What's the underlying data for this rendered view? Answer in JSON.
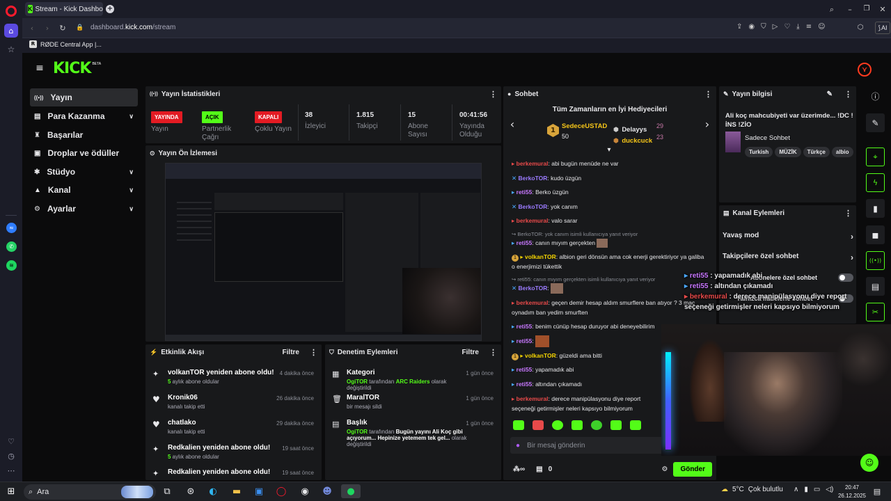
{
  "browser": {
    "tab_title": "Stream - Kick Dashboard",
    "new_tab": "+",
    "url_host_pre": "dashboard.",
    "url_host": "kick.com",
    "url_path": "/stream",
    "bookmark": "RØDE Central App |...",
    "ai_label": "AI"
  },
  "kick": {
    "logo": "KICK",
    "logo_sup": "BETA"
  },
  "nav": [
    {
      "label": "Yayın",
      "icon": "((•))",
      "active": true,
      "chev": ""
    },
    {
      "label": "Para Kazanma",
      "icon": "▤",
      "chev": "v"
    },
    {
      "label": "Başarılar",
      "icon": "🏆",
      "chev": ""
    },
    {
      "label": "Droplar ve ödüller",
      "icon": "▣",
      "chev": ""
    },
    {
      "label": "Stüdyo",
      "icon": "✱",
      "chev": "v"
    },
    {
      "label": "Kanal",
      "icon": "▲",
      "chev": "v"
    },
    {
      "label": "Ayarlar",
      "icon": "⚙",
      "chev": "v"
    }
  ],
  "stats": {
    "title": "Yayın İstatistikleri",
    "items": [
      {
        "value": "YAYINDA",
        "label": "Yayın",
        "badge": "red"
      },
      {
        "value": "AÇIK",
        "label": "Partnerlik Çağrı",
        "badge": "green"
      },
      {
        "value": "KAPALI",
        "label": "Çoklu Yayın",
        "badge": "red"
      },
      {
        "value": "38",
        "label": "İzleyici"
      },
      {
        "value": "1.815",
        "label": "Takipçi"
      },
      {
        "value": "15",
        "label": "Abone Sayısı"
      },
      {
        "value": "00:41:56",
        "label": "Yayında Olduğu"
      }
    ]
  },
  "preview": {
    "title": "Yayın Ön İzlemesi"
  },
  "activity": {
    "title": "Etkinlik Akışı",
    "filter": "Filtre",
    "events": [
      {
        "icon": "✦",
        "title": "volkanTOR yeniden abone oldu!",
        "sub_hl": "5",
        "sub": " aylık abone oldular",
        "time": "4 dakika önce"
      },
      {
        "icon": "♥",
        "title": "Kronik06",
        "sub": "kanalı takip etti",
        "time": "26 dakika önce"
      },
      {
        "icon": "♥",
        "title": "chatlako",
        "sub": "kanalı takip etti",
        "time": "29 dakika önce"
      },
      {
        "icon": "✦",
        "title": "Redkalien yeniden abone oldu!",
        "sub_hl": "5",
        "sub": " aylık abone oldular",
        "time": "19 saat önce"
      },
      {
        "icon": "✦",
        "title": "Redkalien yeniden abone oldu!",
        "sub": "",
        "time": "19 saat önce"
      }
    ]
  },
  "moderation": {
    "title": "Denetim Eylemleri",
    "filter": "Filtre",
    "events": [
      {
        "icon": "▦",
        "title": "Kategori",
        "actor": "OgiTOR",
        "mid": " tarafından ",
        "obj": "ARC Raiders",
        "tail": " olarak değiştirildi",
        "time": "1 gün önce"
      },
      {
        "icon": "🗑",
        "title": "MaralTOR",
        "tail": "bir mesajı sildi",
        "time": "1 gün önce"
      },
      {
        "icon": "▤",
        "title": "Başlık",
        "actor": "OgiTOR",
        "mid": " tarafından ",
        "obj": "Bugün yayını Ali Koç gibi açıyorum... Hepinize yetemem tek gel...",
        "tail": " olarak değiştirildi",
        "time": "1 gün önce"
      }
    ]
  },
  "chat": {
    "title": "Sohbet",
    "gifters_title": "Tüm Zamanların en İyi Hediyecileri",
    "gifters": [
      {
        "rank": "1",
        "name": "SedeceUSTAD",
        "count": "50"
      },
      {
        "rank": "",
        "name": "Delayys",
        "count": "29"
      },
      {
        "rank": "",
        "name": "duckcuck",
        "count": "23"
      }
    ],
    "messages": [
      {
        "user": "berkemural",
        "color": "#e84a4a",
        "text": "abi bugün menüde ne var"
      },
      {
        "user": "BerkoTOR",
        "color": "#9b7bff",
        "text": "kudo üzgün"
      },
      {
        "user": "reti55",
        "color": "#c878ff",
        "text": "Berko üzgün"
      },
      {
        "user": "BerkoTOR",
        "color": "#9b7bff",
        "text": "yok canım"
      },
      {
        "user": "berkemural",
        "color": "#e84a4a",
        "text": "valo sarar"
      },
      {
        "reply": "↪ BerkoTOR: yok canım isimli kullanıcıya yanıt veriyor"
      },
      {
        "user": "reti55",
        "color": "#c878ff",
        "text": "canın mıyım gerçekten"
      },
      {
        "user": "volkanTOR",
        "color": "#f5d400",
        "text": "albion geri dönsün ama cok enerji gerektiriyor ya galiba o enerjimizi tükettik"
      },
      {
        "reply": "↪ reti55: canın mıyım gerçekten isimli kullanıcıya yanıt veriyor"
      },
      {
        "user": "BerkoTOR",
        "color": "#9b7bff",
        "text": ""
      },
      {
        "user": "berkemural",
        "color": "#e84a4a",
        "text": "geçen demir hesap aldım smurflere ban atıyor ? 3 maç oynadım ban yedim smurften"
      },
      {
        "user": "reti55",
        "color": "#c878ff",
        "text": "benim cünüp hesap duruyor abi deneyebilirim"
      },
      {
        "user": "reti55",
        "color": "#c878ff",
        "text": ""
      },
      {
        "user": "volkanTOR",
        "color": "#f5d400",
        "text": "güzeldi ama bitti"
      },
      {
        "user": "reti55",
        "color": "#c878ff",
        "text": "yapamadık abi"
      },
      {
        "user": "reti55",
        "color": "#c878ff",
        "text": "altından çıkamadı"
      },
      {
        "user": "berkemural",
        "color": "#e84a4a",
        "text": "derece manipülasyonu diye report seçeneği getirmişler neleri kapsıyo bilmiyorum"
      }
    ],
    "input_placeholder": "Bir mesaj gönderin",
    "points": "0",
    "send": "Gönder"
  },
  "stream_info": {
    "title": "Yayın bilgisi",
    "stream_title": "Ali koç mahcubiyeti var üzerimde... !DC !İNS !ZİO",
    "category": "Sadece Sohbet",
    "tags": [
      "Turkish",
      "MÜZİK",
      "Türkçe",
      "albio"
    ]
  },
  "channel_actions": {
    "title": "Kanal Eylemleri",
    "items": [
      "Yavaş mod",
      "Takipçilere özel sohbet",
      "Abonelere özel sohbet",
      "Yalnızca ifadelerle sohbet"
    ]
  },
  "overlay_chat": [
    {
      "user": "reti55",
      "text": "yapamadık abi"
    },
    {
      "user": "reti55",
      "text": "altından çıkamadı"
    },
    {
      "user": "berkemural",
      "text": "derece manipülasyonu diye report seçeneği getirmişler neleri kapsıyo bilmiyorum"
    }
  ],
  "taskbar": {
    "search": "Ara",
    "temp": "5°C",
    "weather": "Çok bulutlu",
    "time": "20:47",
    "date": "26.12.2025"
  }
}
